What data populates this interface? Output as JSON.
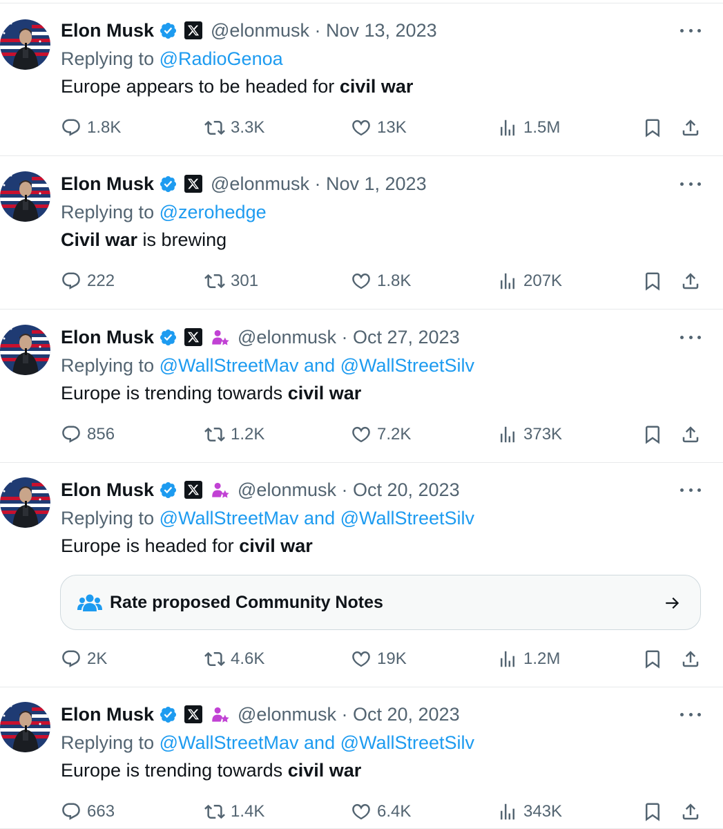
{
  "colors": {
    "accent": "#1d9bf0",
    "text": "#0f1419",
    "secondary": "#536471",
    "border": "#e7e9ea",
    "affiliate": "#c142d4"
  },
  "tweets": [
    {
      "name": "Elon Musk",
      "handle": "@elonmusk",
      "separator": " · ",
      "date": "Nov 13, 2023",
      "show_affiliate_badge": false,
      "replying_prefix": "Replying to ",
      "replying_to": "@RadioGenoa",
      "body_before": "Europe appears to be headed for ",
      "body_bold": "civil war",
      "body_after": "",
      "replies": "1.8K",
      "reposts": "3.3K",
      "likes": "13K",
      "views": "1.5M"
    },
    {
      "name": "Elon Musk",
      "handle": "@elonmusk",
      "separator": " · ",
      "date": "Nov 1, 2023",
      "show_affiliate_badge": false,
      "replying_prefix": "Replying to ",
      "replying_to": "@zerohedge",
      "body_before": "",
      "body_bold": "Civil war",
      "body_after": " is brewing",
      "replies": "222",
      "reposts": "301",
      "likes": "1.8K",
      "views": "207K"
    },
    {
      "name": "Elon Musk",
      "handle": "@elonmusk",
      "separator": " · ",
      "date": "Oct 27, 2023",
      "show_affiliate_badge": true,
      "replying_prefix": "Replying to ",
      "replying_to": "@WallStreetMav and @WallStreetSilv",
      "body_before": "Europe is trending towards ",
      "body_bold": "civil war",
      "body_after": "",
      "replies": "856",
      "reposts": "1.2K",
      "likes": "7.2K",
      "views": "373K"
    },
    {
      "name": "Elon Musk",
      "handle": "@elonmusk",
      "separator": " · ",
      "date": "Oct 20, 2023",
      "show_affiliate_badge": true,
      "replying_prefix": "Replying to ",
      "replying_to": "@WallStreetMav and @WallStreetSilv",
      "body_before": "Europe is headed for ",
      "body_bold": "civil war",
      "body_after": "",
      "community_notes_label": "Rate proposed Community Notes",
      "replies": "2K",
      "reposts": "4.6K",
      "likes": "19K",
      "views": "1.2M"
    },
    {
      "name": "Elon Musk",
      "handle": "@elonmusk",
      "separator": " · ",
      "date": "Oct 20, 2023",
      "show_affiliate_badge": true,
      "replying_prefix": "Replying to ",
      "replying_to": "@WallStreetMav and @WallStreetSilv",
      "body_before": "Europe is trending towards ",
      "body_bold": "civil war",
      "body_after": "",
      "replies": "663",
      "reposts": "1.4K",
      "likes": "6.4K",
      "views": "343K"
    }
  ]
}
